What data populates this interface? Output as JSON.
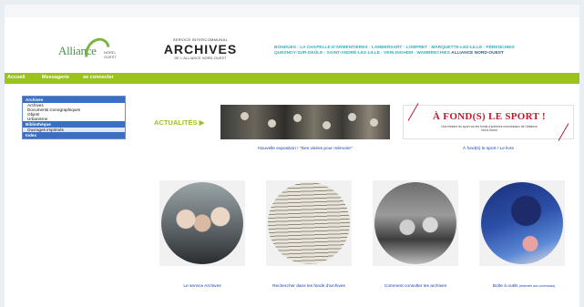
{
  "header": {
    "logo_text": "Alliance",
    "logo_small": "NORD-OUEST",
    "archives_top": "SERVICE INTERCOMMUNAL",
    "archives_title": "ARCHIVES",
    "archives_sub": "DE L'ALLIANCE NORD-OUEST",
    "communes_line1": "BONDUES · LA CHAPELLE D'ARMENTIÈRES · LAMBERSART · LOMPRET · MARQUETTE-LEZ-LILLE · PÉRENCHIES",
    "communes_line2": "QUESNOY-SUR-DEÛLE · SAINT-ANDRÉ-LEZ-LILLE · VERLINGHEM · WAMBRECHIES",
    "communes_highlight": "ALLIANCE NORD-OUEST"
  },
  "nav": {
    "items": [
      "Accueil",
      "Messagerie",
      "se connecter"
    ]
  },
  "menu": {
    "sections": [
      {
        "title": "Archives",
        "items": [
          "Archives",
          "Documents iconographiques",
          "Objets",
          "Urbanisme"
        ]
      },
      {
        "title": "Bibliothèque",
        "items": [
          "Ouvrages imprimés"
        ]
      },
      {
        "title": "Index",
        "items": []
      }
    ]
  },
  "news": {
    "label": "ACTUALITÉS ▶",
    "item1_caption": "Nouvelle exposition ! \"Des visées pour mémoire\"",
    "item2_title": "À FOND(S) LE SPORT !",
    "item2_sub": "Une histoire du sport via les fonds d'archives communaux de l'Alliance Nord-Ouest",
    "item2_caption": "À fond(s) le sport ! Le livre"
  },
  "cards": [
    {
      "label": "Le service Archives"
    },
    {
      "label": "Rechercher dans les fonds d'archives"
    },
    {
      "label": "Comment consulter les archives"
    },
    {
      "label": "Boîte à outils",
      "label_extra": "(réservée aux communes)"
    }
  ],
  "colors": {
    "nav_green": "#9ac31c",
    "menu_blue": "#3a6fc4",
    "link_blue": "#1a3ea8",
    "communes_teal": "#2bb3c0",
    "sport_red": "#c21a2a"
  }
}
